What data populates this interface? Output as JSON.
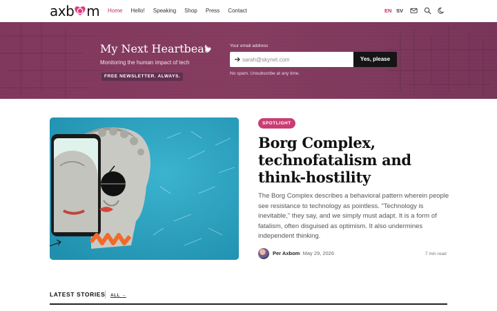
{
  "header": {
    "logo_text_left": "axb",
    "logo_text_right": "m",
    "nav": [
      "Home",
      "Hello!",
      "Speaking",
      "Shop",
      "Press",
      "Contact"
    ],
    "active_nav": "Home",
    "lang_en": "EN",
    "lang_sv": "SV",
    "icons": [
      "mail-icon",
      "search-icon",
      "moon-icon"
    ]
  },
  "hero": {
    "title": "My Next Heartbeat",
    "subtitle": "Monitoring the human impact of tech",
    "badge": "FREE NEWSLETTER. ALWAYS.",
    "email_label": "Your email address",
    "email_placeholder": "sarah@skynet.com",
    "submit_label": "Yes, please",
    "disclaimer": "No spam. Unsubscribe at any time."
  },
  "feature": {
    "tag": "SPOTLIGHT",
    "title": "Borg Complex, technofatalism and think-hostility",
    "excerpt": "The Borg Complex describes a behavioral pattern wherein people see resistance to technology as pointless. \"Technology is inevitable,\" they say, and we simply must adapt. It is a form of fatalism, often disguised as optimism. It also undermines independent thinking.",
    "author": "Per Axbom",
    "date": "· May 29, 2026",
    "read_time": "7 min read"
  },
  "latest": {
    "title": "LATEST STORIES",
    "all_link": "ALL →"
  },
  "colors": {
    "accent": "#c93d74",
    "hero_bg": "#833a62",
    "button_bg": "#151515"
  }
}
